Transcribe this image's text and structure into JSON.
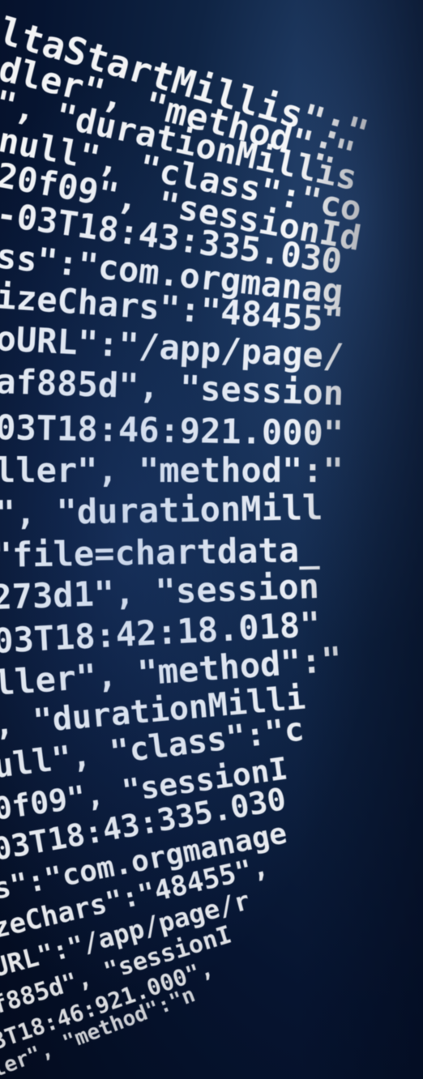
{
  "code_lines": [
    "ltaStartMillis\":\"",
    "dler\", \"method\":\"",
    "\", \"durationMillis",
    "null\", \"class\":\"co",
    "20f09\", \"sessionId",
    "-03T18:43:335.030",
    "ss\":\"com.orgmanag",
    "izeChars\":\"48455\"",
    "oURL\":\"/app/page/",
    "af885d\", \"session",
    "03T18:46:921.000\"",
    "ller\", \"method\":\"",
    "\", \"durationMill",
    "\"file=chartdata_",
    "273d1\", \"session",
    "03T18:42:18.018\"",
    "ller\", \"method\":\"",
    ", \"durationMilli",
    "ull\", \"class\":\"c",
    "0f09\", \"sessionI",
    "03T18:43:335.030",
    "s\":\"com.orgmanage",
    "zeChars\":\"48455\",",
    "URL\":\"/app/page/r",
    "f885d\", \"sessionI",
    "3T18:46:921.000\",",
    "ler\", \"method\":\"n"
  ],
  "colors": {
    "text": "#ffffff",
    "background_dark": "#030b1e",
    "background_mid": "#0f2444",
    "background_light": "#2a4a78"
  }
}
